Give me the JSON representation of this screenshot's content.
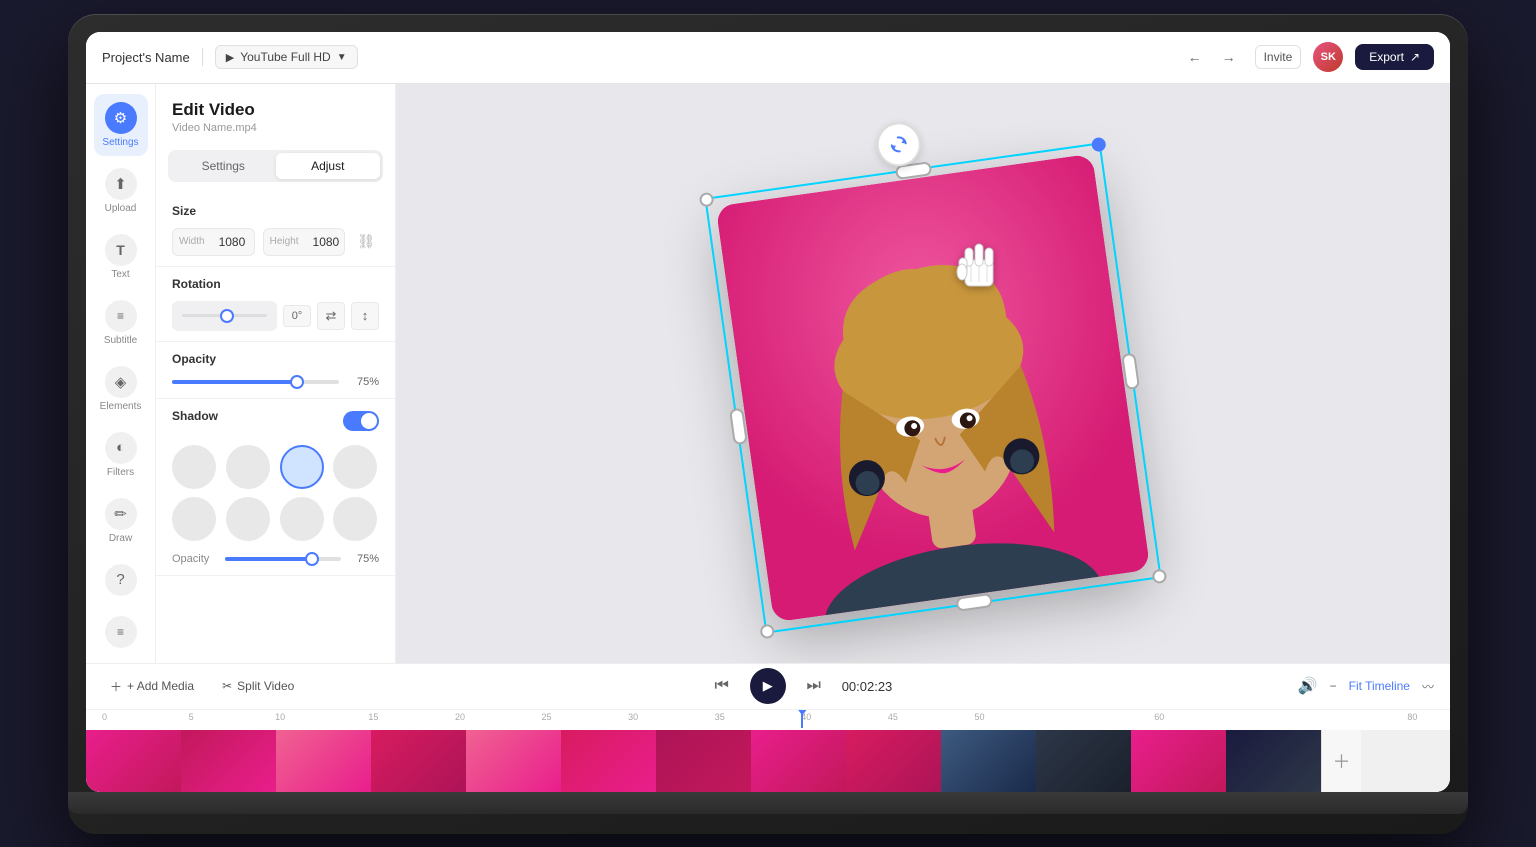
{
  "topbar": {
    "project_name": "Project's Name",
    "format": "YouTube Full HD",
    "format_icon": "▶",
    "undo_label": "←",
    "redo_label": "→",
    "invite_label": "Invite",
    "user_initials": "SK",
    "export_label": "Export",
    "share_icon": "↗"
  },
  "sidebar": {
    "items": [
      {
        "label": "Settings",
        "icon": "⚙",
        "active": true
      },
      {
        "label": "Upload",
        "icon": "⬆",
        "active": false
      },
      {
        "label": "Text",
        "icon": "T",
        "active": false
      },
      {
        "label": "Subtitle",
        "icon": "≡",
        "active": false
      },
      {
        "label": "Elements",
        "icon": "◈",
        "active": false
      },
      {
        "label": "Filters",
        "icon": "◐",
        "active": false
      },
      {
        "label": "Draw",
        "icon": "✏",
        "active": false
      }
    ],
    "help_icon": "?",
    "caption_icon": "≡"
  },
  "panel": {
    "title": "Edit Video",
    "subtitle": "Video Name.mp4",
    "tabs": [
      "Settings",
      "Adjust"
    ],
    "active_tab": "Adjust",
    "size": {
      "label": "Size",
      "width_label": "Width",
      "width_value": "1080",
      "height_label": "Height",
      "height_value": "1080"
    },
    "rotation": {
      "label": "Rotation",
      "value": "0°",
      "flip_icon": "⇄"
    },
    "opacity": {
      "label": "Opacity",
      "value": "75%",
      "percent": 75
    },
    "shadow": {
      "label": "Shadow",
      "enabled": true,
      "opacity_label": "Opacity",
      "opacity_value": "75%",
      "opacity_percent": 75
    }
  },
  "toolbar": {
    "add_media": "+ Add Media",
    "split_video": "Split Video",
    "split_icon": "✂",
    "rewind_icon": "⏮",
    "play_icon": "▶",
    "forward_icon": "⏭",
    "time": "00:02:23",
    "volume_icon": "🔊",
    "minus_icon": "−",
    "fit_timeline": "Fit Timeline",
    "wave_icon": "〰"
  },
  "timeline": {
    "markers": [
      "0",
      "5",
      "10",
      "15",
      "20",
      "25",
      "30",
      "35",
      "40",
      "45",
      "50",
      "60",
      "80"
    ],
    "playhead_position": "52%"
  }
}
